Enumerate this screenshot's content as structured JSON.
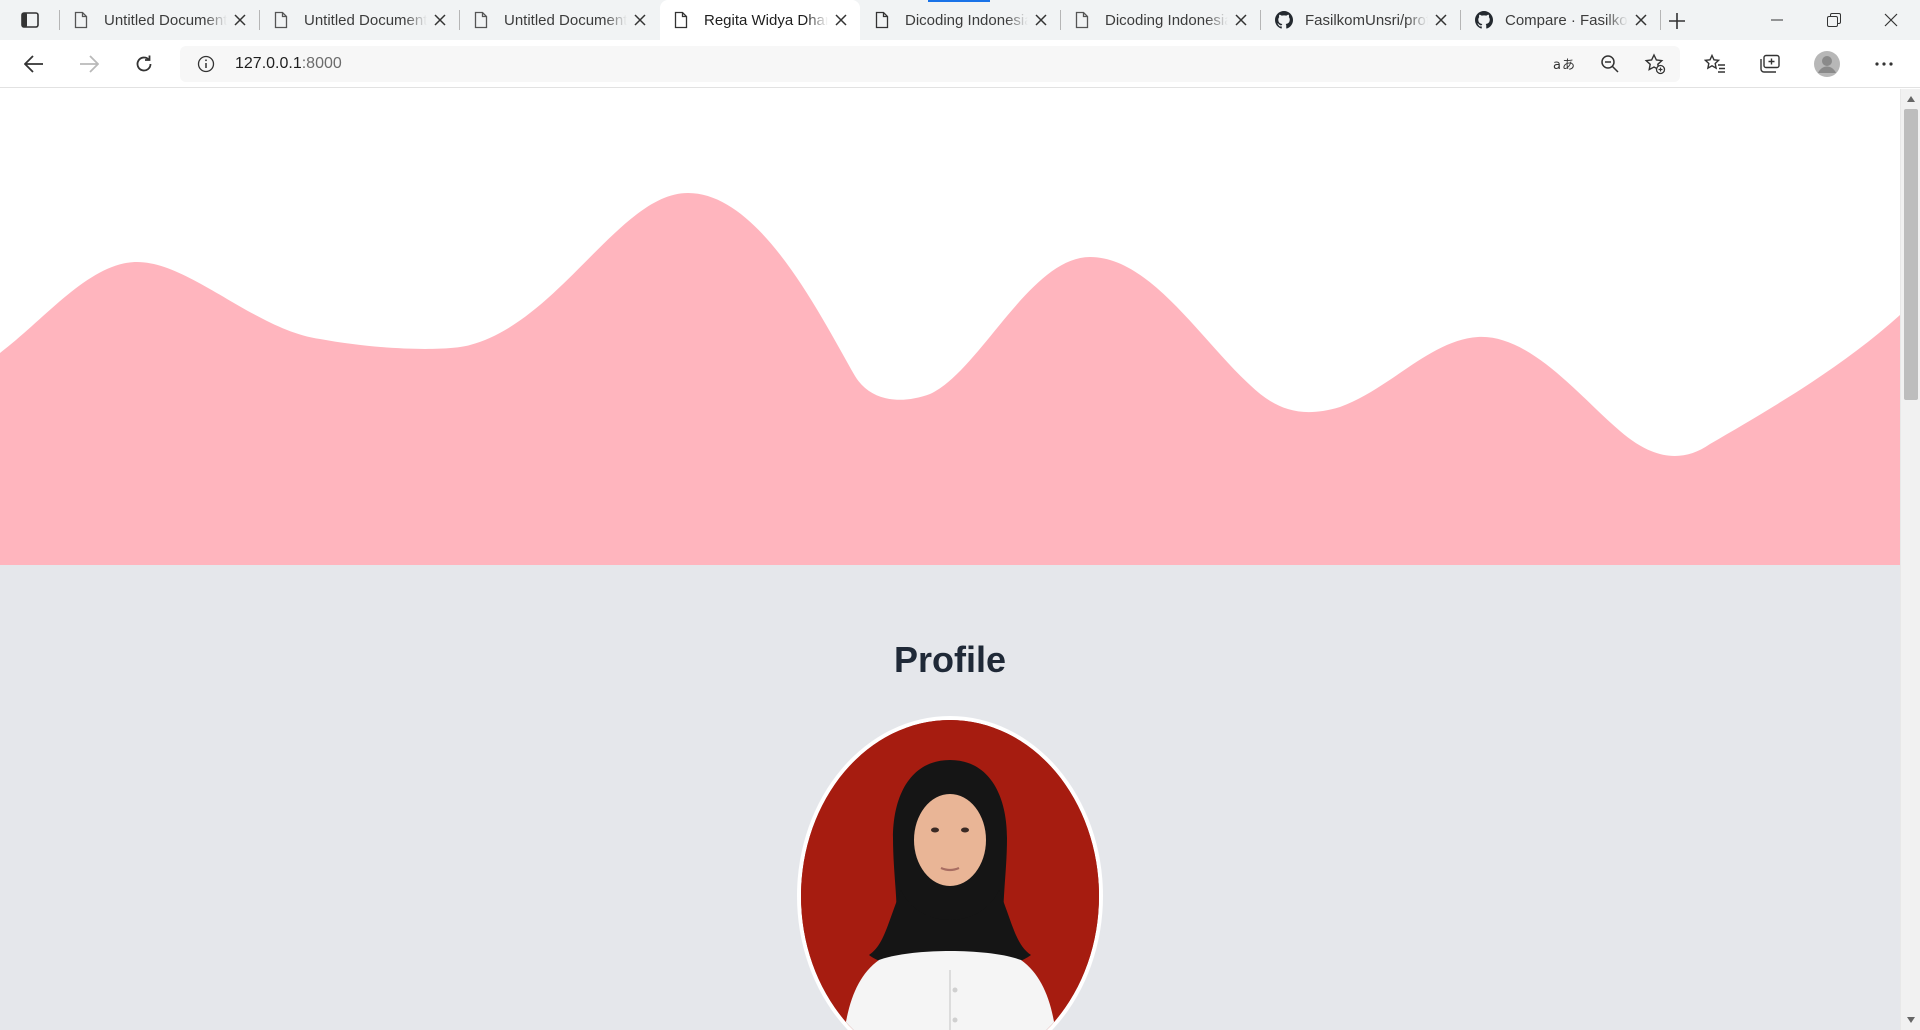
{
  "browser": {
    "tabs": [
      {
        "title": "Untitled Document",
        "icon": "page-icon",
        "active": false
      },
      {
        "title": "Untitled Document",
        "icon": "page-icon",
        "active": false
      },
      {
        "title": "Untitled Document",
        "icon": "page-icon",
        "active": false
      },
      {
        "title": "Regita Widya Dhamayanti",
        "icon": "page-icon",
        "active": true
      },
      {
        "title": "Dicoding Indonesia",
        "icon": "page-icon",
        "active": false
      },
      {
        "title": "Dicoding Indonesia",
        "icon": "page-icon",
        "active": false
      },
      {
        "title": "FasilkomUnsri/profile",
        "icon": "github-icon",
        "active": false
      },
      {
        "title": "Compare · FasilkomUnsri",
        "icon": "github-icon",
        "active": false
      }
    ],
    "address": {
      "host": "127.0.0.1",
      "port": ":8000"
    },
    "icons": {
      "tab_actions": "tab-actions-icon",
      "new_tab": "plus-icon",
      "minimize": "minimize-icon",
      "restore": "restore-icon",
      "close": "close-icon",
      "back": "back-arrow-icon",
      "forward": "forward-arrow-icon",
      "reload": "reload-icon",
      "site_info": "info-icon",
      "read_aloud": "translate-icon",
      "zoom": "zoom-out-icon",
      "add_favorite": "star-add-icon",
      "favorites": "favorites-icon",
      "collections": "collections-icon",
      "profile": "profile-avatar-icon",
      "menu": "more-horizontal-icon"
    }
  },
  "page": {
    "hero": {
      "wave_color": "#ffb5be",
      "background": "#ffffff"
    },
    "profile": {
      "title": "Profile",
      "photo_background": "#a61c10"
    },
    "background": "#e5e7eb"
  },
  "colors": {
    "accent": "#1a73e8",
    "tabstrip": "#f1f3f4",
    "text": "#1f2937"
  }
}
